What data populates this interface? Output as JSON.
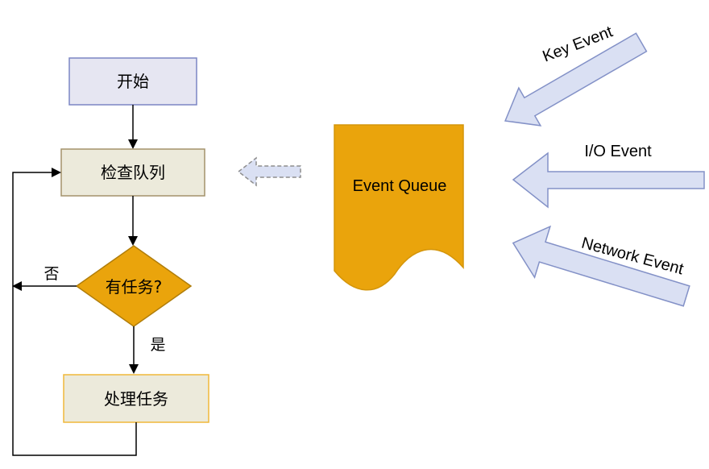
{
  "flowchart": {
    "start": "开始",
    "check_queue": "检查队列",
    "has_task": "有任务?",
    "process_task": "处理任务",
    "no": "否",
    "yes": "是"
  },
  "queue": {
    "label": "Event Queue"
  },
  "events": {
    "key": "Key Event",
    "io": "I/O Event",
    "network": "Network Event"
  },
  "colors": {
    "start_fill": "#e6e6f2",
    "start_stroke": "#7b85c4",
    "check_fill": "#eceadb",
    "check_stroke": "#a3926b",
    "decision_fill": "#eaa40c",
    "decision_stroke": "#b07d0a",
    "process_fill": "#eceadb",
    "process_stroke": "#f0b83a",
    "queue_fill": "#eaa40c",
    "queue_stroke": "#d4950a",
    "event_arrow_fill": "#dae0f3",
    "event_arrow_stroke": "#8391c7",
    "line": "#000000"
  }
}
